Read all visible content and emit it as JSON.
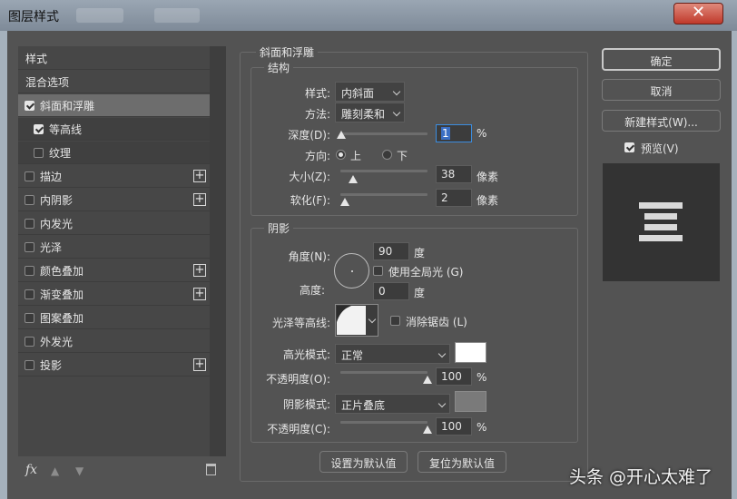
{
  "window": {
    "title": "图层样式",
    "close_glyph": "✕"
  },
  "left_list": {
    "header_label": "样式",
    "blend_label": "混合选项",
    "items": [
      {
        "label": "斜面和浮雕",
        "checked": true,
        "plus": false
      },
      {
        "label": "等高线",
        "checked": true,
        "plus": false
      },
      {
        "label": "纹理",
        "checked": false,
        "plus": false
      },
      {
        "label": "描边",
        "checked": false,
        "plus": true
      },
      {
        "label": "内阴影",
        "checked": false,
        "plus": true
      },
      {
        "label": "内发光",
        "checked": false,
        "plus": false
      },
      {
        "label": "光泽",
        "checked": false,
        "plus": false
      },
      {
        "label": "颜色叠加",
        "checked": false,
        "plus": true
      },
      {
        "label": "渐变叠加",
        "checked": false,
        "plus": true
      },
      {
        "label": "图案叠加",
        "checked": false,
        "plus": false
      },
      {
        "label": "外发光",
        "checked": false,
        "plus": false
      },
      {
        "label": "投影",
        "checked": false,
        "plus": true
      }
    ],
    "plus_glyph": "+",
    "fx_label": "fx",
    "up_icon": "up-arrow-icon",
    "down_icon": "down-arrow-icon",
    "trash_icon": "trash-icon"
  },
  "bevel": {
    "section_title": "斜面和浮雕",
    "structure_title": "结构",
    "style_label": "样式:",
    "style_value": "内斜面",
    "technique_label": "方法:",
    "technique_value": "雕刻柔和",
    "depth_label": "深度(D):",
    "depth_value": "1",
    "depth_unit": "%",
    "depth_slider": 0.01,
    "direction_label": "方向:",
    "direction_up": "上",
    "direction_down": "下",
    "size_label": "大小(Z):",
    "size_value": "38",
    "size_unit": "像素",
    "size_slider": 0.15,
    "soften_label": "软化(F):",
    "soften_value": "2",
    "soften_unit": "像素",
    "soften_slider": 0.05
  },
  "shading": {
    "title": "阴影",
    "angle_label": "角度(N):",
    "angle_value": "90",
    "angle_unit": "度",
    "global_light_label": "使用全局光 (G)",
    "global_light_checked": false,
    "altitude_label": "高度:",
    "altitude_value": "0",
    "altitude_unit": "度",
    "gloss_label": "光泽等高线:",
    "antialias_label": "消除锯齿 (L)",
    "antialias_checked": false,
    "highlight_mode_label": "高光模式:",
    "highlight_mode_value": "正常",
    "highlight_color": "#ffffff",
    "highlight_opacity_label": "不透明度(O):",
    "highlight_opacity_value": "100",
    "highlight_opacity_unit": "%",
    "highlight_opacity_slider": 1.0,
    "shadow_mode_label": "阴影模式:",
    "shadow_mode_value": "正片叠底",
    "shadow_color": "#7a7a7a",
    "shadow_opacity_label": "不透明度(C):",
    "shadow_opacity_value": "100",
    "shadow_opacity_unit": "%",
    "shadow_opacity_slider": 1.0
  },
  "footer": {
    "make_default": "设置为默认值",
    "reset_default": "复位为默认值"
  },
  "actions": {
    "ok": "确定",
    "cancel": "取消",
    "new_style": "新建样式(W)...",
    "preview_label": "预览(V)",
    "preview_checked": true
  },
  "watermark": "头条 @开心太难了"
}
